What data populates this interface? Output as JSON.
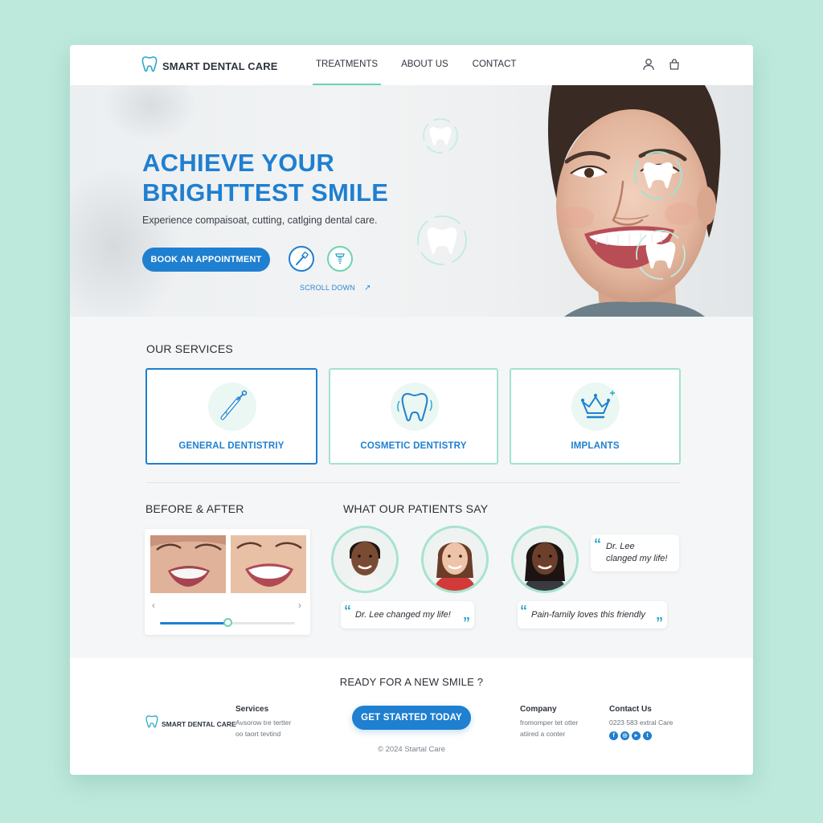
{
  "brand": {
    "name": "SMART DENTAL CARE",
    "accent": "#1f7fd0",
    "mint": "#6dd3b0"
  },
  "nav": {
    "items": [
      "TREATMENTS",
      "ABOUT US",
      "CONTACT"
    ],
    "active": "TREATMENTS"
  },
  "header_icons": [
    "user-icon",
    "bag-icon"
  ],
  "hero": {
    "title_line1": "ACHIEVE YOUR",
    "title_line2": "BRIGHTTEST SMILE",
    "subtitle": "Experience compaisoat, cutting, catlging dental care.",
    "cta": "BOOK AN APPOINTMENT",
    "icons": [
      "toothbrush-icon",
      "implant-icon"
    ],
    "scroll": "SCROLL DOWN"
  },
  "services": {
    "title": "OUR SERVICES",
    "items": [
      {
        "label": "GENERAL DENTISTRIY",
        "icon": "dental-drill-icon"
      },
      {
        "label": "COSMETIC DENTISTRY",
        "icon": "tooth-sparkle-icon"
      },
      {
        "label": "IMPLANTS",
        "icon": "crown-icon"
      }
    ]
  },
  "before_after": {
    "title": "BEFORE & AFTER",
    "prev": "‹",
    "next": "›",
    "slider_progress": 0.5
  },
  "testimonials": {
    "title": "WHAT OUR PATIENTS SAY",
    "quotes": [
      {
        "text": "Dr. Lee changed my life!"
      },
      {
        "text": "Pain-family loves this friendly"
      },
      {
        "text_line1": "Dr. Lee",
        "text_line2": "clanged my life!"
      }
    ]
  },
  "footer": {
    "cta_title": "READY FOR A NEW SMILE ?",
    "cta_button": "GET STARTED TODAY",
    "logo_text": "SMART DENTAL CARE",
    "services_head": "Services",
    "services_line1": "Avsorow tre tertter",
    "services_line2": "oo taort tevtind",
    "company_head": "Company",
    "company_line1": "fromomper tet otter",
    "company_line2": "atiired a conter",
    "contact_head": "Contact Us",
    "contact_line1": "0223 583 extral Care",
    "social": [
      "facebook-icon",
      "instagram-icon",
      "youtube-icon",
      "twitter-icon"
    ],
    "copyright": "© 2024 Startal Care"
  }
}
